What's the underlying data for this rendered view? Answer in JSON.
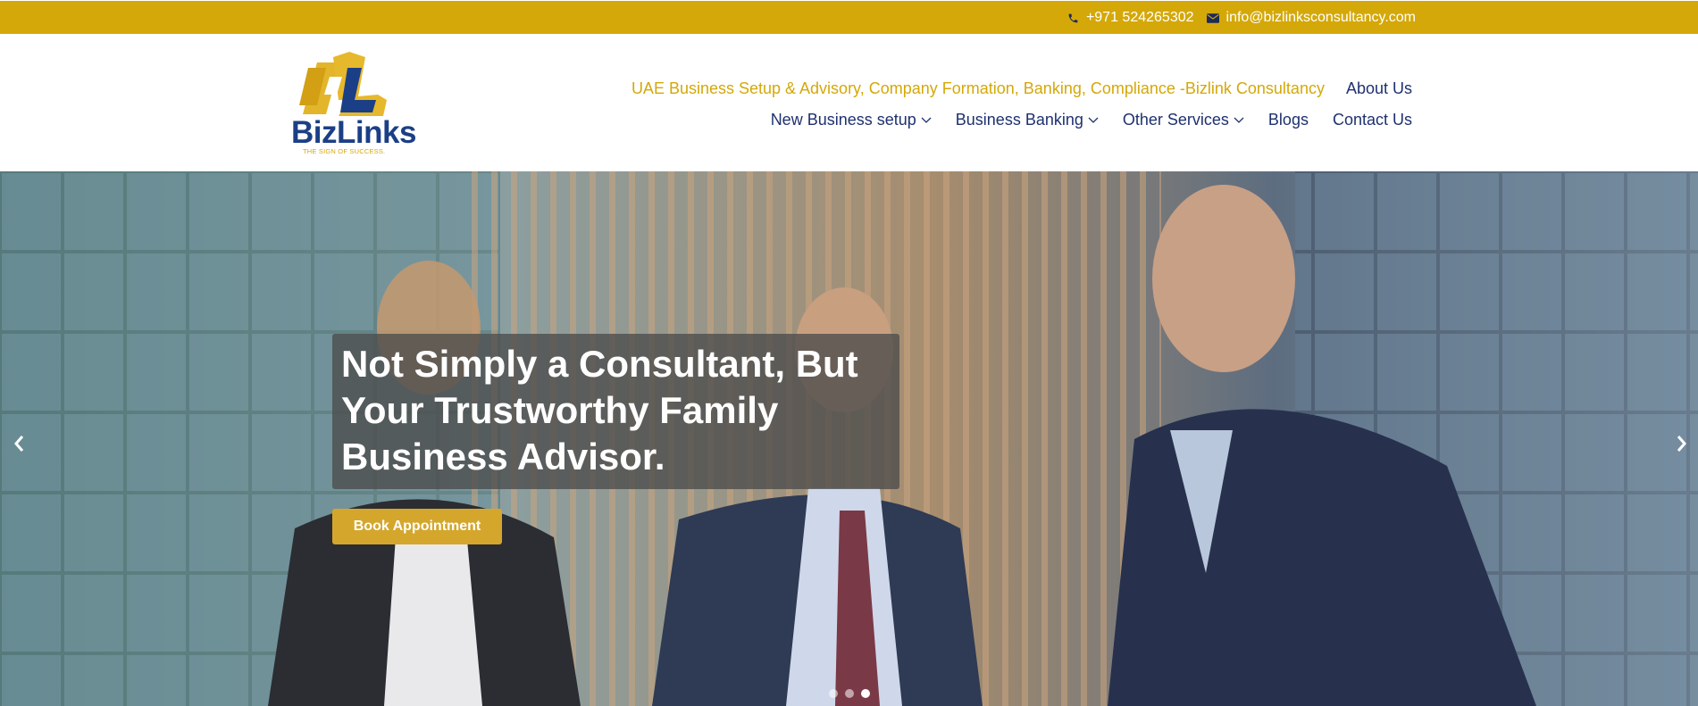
{
  "topbar": {
    "phone": "+971 524265302",
    "email": "info@bizlinksconsultancy.com",
    "phone_icon": "phone-icon",
    "email_icon": "envelope-icon"
  },
  "logo": {
    "mark": "BL",
    "wordmark": "BizLinks",
    "tagline": "THE SIGN OF SUCCESS."
  },
  "nav": {
    "row1": [
      {
        "label": "UAE Business Setup & Advisory, Company Formation, Banking, Compliance -Bizlink Consultancy",
        "active": true
      },
      {
        "label": "About Us"
      }
    ],
    "row2": [
      {
        "label": "New Business setup",
        "dropdown": true
      },
      {
        "label": "Business Banking",
        "dropdown": true
      },
      {
        "label": "Other Services",
        "dropdown": true
      },
      {
        "label": "Blogs"
      },
      {
        "label": "Contact Us"
      }
    ]
  },
  "hero": {
    "headline": "Not Simply a Consultant, But Your Trustworthy Family Business Advisor.",
    "cta_label": "Book Appointment",
    "slides_count": 3,
    "active_slide": 3,
    "prev_icon": "chevron-left-icon",
    "next_icon": "chevron-right-icon"
  },
  "colors": {
    "brand_gold": "#d4a809",
    "brand_navy": "#1e3170",
    "button_gold": "#d4a72c"
  }
}
